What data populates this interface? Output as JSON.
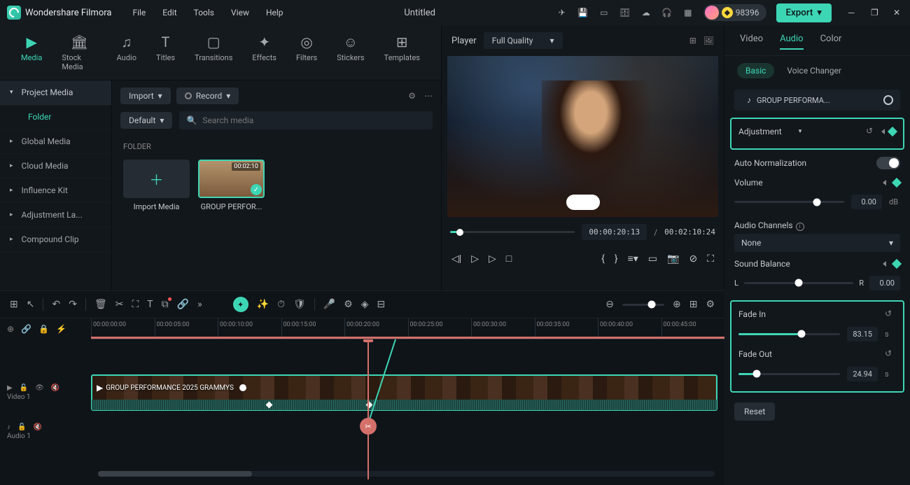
{
  "app": {
    "title": "Wondershare Filmora",
    "document": "Untitled"
  },
  "menu": [
    "File",
    "Edit",
    "Tools",
    "View",
    "Help"
  ],
  "coins": "98396",
  "export_label": "Export",
  "ribbon": [
    {
      "label": "Media",
      "active": true
    },
    {
      "label": "Stock Media"
    },
    {
      "label": "Audio"
    },
    {
      "label": "Titles"
    },
    {
      "label": "Transitions"
    },
    {
      "label": "Effects"
    },
    {
      "label": "Filters"
    },
    {
      "label": "Stickers"
    },
    {
      "label": "Templates"
    }
  ],
  "sidebar": {
    "items": [
      {
        "label": "Project Media",
        "selected": true
      },
      {
        "label": "Folder",
        "sub": true,
        "active": true
      },
      {
        "label": "Global Media"
      },
      {
        "label": "Cloud Media"
      },
      {
        "label": "Influence Kit"
      },
      {
        "label": "Adjustment La..."
      },
      {
        "label": "Compound Clip"
      }
    ]
  },
  "toolbar": {
    "import": "Import",
    "record": "Record",
    "sort": "Default",
    "search_placeholder": "Search media"
  },
  "folder_label": "FOLDER",
  "media": {
    "import_label": "Import Media",
    "clip": {
      "name": "GROUP PERFOR...",
      "duration": "00:02:10"
    }
  },
  "player": {
    "label": "Player",
    "quality": "Full Quality",
    "current": "00:00:20:13",
    "total": "00:02:10:24"
  },
  "tabs": [
    "Video",
    "Audio",
    "Color"
  ],
  "subtabs": [
    "Basic",
    "Voice Changer"
  ],
  "audio_clip": "GROUP PERFORMA...",
  "adjustment": {
    "title": "Adjustment"
  },
  "auto_norm": "Auto Normalization",
  "volume": {
    "label": "Volume",
    "value": "0.00",
    "unit": "dB"
  },
  "channels": {
    "label": "Audio Channels",
    "value": "None"
  },
  "balance": {
    "label": "Sound Balance",
    "left": "L",
    "right": "R",
    "value": "0.00"
  },
  "fade_in": {
    "label": "Fade In",
    "value": "83.15",
    "unit": "s"
  },
  "fade_out": {
    "label": "Fade Out",
    "value": "24.94",
    "unit": "s"
  },
  "reset": "Reset",
  "ruler": [
    "00:00:00:00",
    "00:00:05:00",
    "00:00:10:00",
    "00:00:15:00",
    "00:00:20:00",
    "00:00:25:00",
    "00:00:30:00",
    "00:00:35:00",
    "00:00:40:00",
    "00:00:45:00"
  ],
  "tracks": {
    "v1": {
      "name": "Video 1",
      "clip": "GROUP PERFORMANCE    2025 GRAMMYS"
    },
    "a1": {
      "name": "Audio 1"
    }
  }
}
